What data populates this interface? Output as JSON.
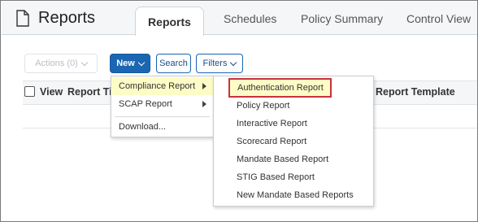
{
  "app": {
    "title": "Reports"
  },
  "tabs": [
    {
      "label": "Reports",
      "active": true
    },
    {
      "label": "Schedules"
    },
    {
      "label": "Policy Summary"
    },
    {
      "label": "Control View"
    }
  ],
  "toolbar": {
    "actions_label": "Actions (0)",
    "new_label": "New",
    "search_label": "Search",
    "filters_label": "Filters"
  },
  "table": {
    "columns": [
      "View",
      "Report Ti",
      "Report Template"
    ]
  },
  "new_menu": {
    "items": [
      "Compliance Report",
      "SCAP Report",
      "Download..."
    ]
  },
  "compliance_submenu": {
    "items": [
      "Authentication Report",
      "Policy Report",
      "Interactive Report",
      "Scorecard Report",
      "Mandate Based Report",
      "STIG Based Report",
      "New Mandate Based Reports"
    ]
  },
  "colors": {
    "primary": "#1a66b3",
    "highlight": "#fefcc6",
    "callout": "#c8323c",
    "header_bg": "#f4f6f8"
  }
}
